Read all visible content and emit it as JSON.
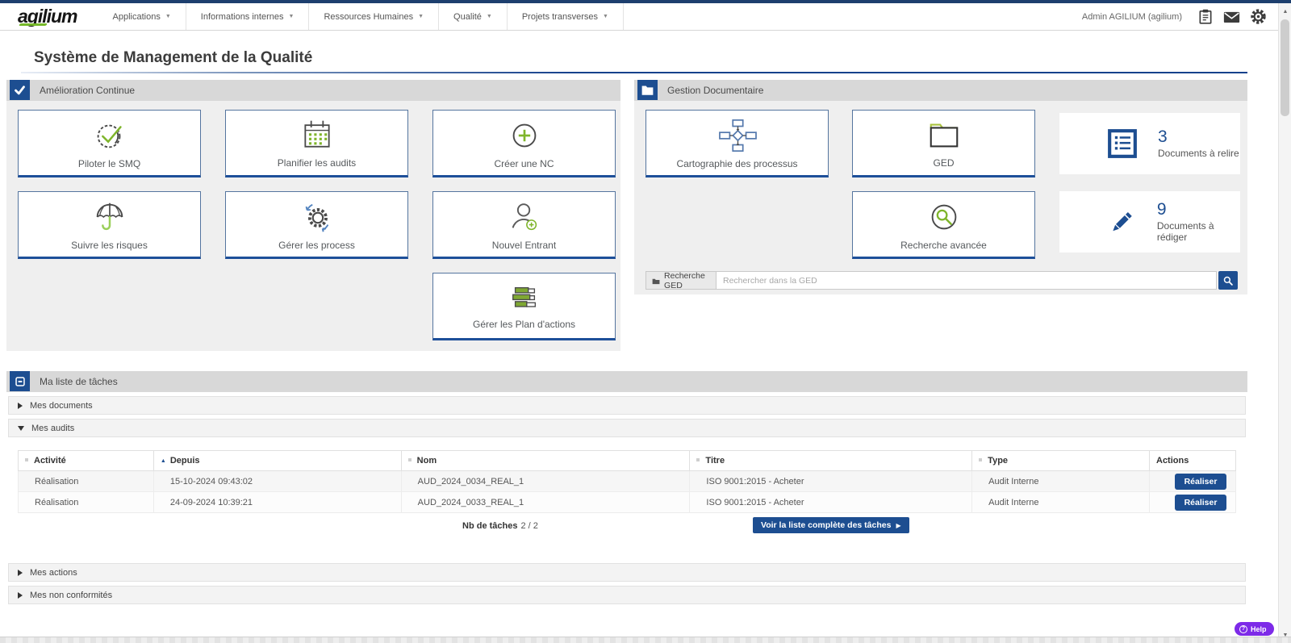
{
  "navbar": {
    "logo": "agilium",
    "menus": [
      "Applications",
      "Informations internes",
      "Ressources Humaines",
      "Qualité",
      "Projets transverses"
    ],
    "user": "Admin AGILIUM (agilium)"
  },
  "page": {
    "title": "Système de Management de la Qualité"
  },
  "amelioration": {
    "title": "Amélioration Continue",
    "tiles": [
      {
        "label": "Piloter le SMQ",
        "icon": "seal-check-icon"
      },
      {
        "label": "Planifier les audits",
        "icon": "calendar-icon"
      },
      {
        "label": "Créer une NC",
        "icon": "plus-circle-icon"
      },
      {
        "label": "Suivre les risques",
        "icon": "umbrella-icon"
      },
      {
        "label": "Gérer les process",
        "icon": "gear-sync-icon"
      },
      {
        "label": "Nouvel Entrant",
        "icon": "user-plus-icon"
      },
      {
        "label": "Gérer les Plan d'actions",
        "icon": "action-bars-icon"
      }
    ]
  },
  "gestion": {
    "title": "Gestion Documentaire",
    "tiles": [
      {
        "label": "Cartographie des processus",
        "icon": "flowchart-icon"
      },
      {
        "label": "GED",
        "icon": "folder-icon"
      },
      {
        "label": "Recherche avancée",
        "icon": "search-circle-icon"
      }
    ],
    "stats": [
      {
        "value": "3",
        "label": "Documents à relire",
        "icon": "list-icon"
      },
      {
        "value": "9",
        "label": "Documents à rédiger",
        "icon": "pencil-icon"
      }
    ],
    "search": {
      "label": "Recherche GED",
      "placeholder": "Rechercher dans la GED"
    }
  },
  "tasks": {
    "title": "Ma liste de tâches",
    "sections": {
      "documents": "Mes documents",
      "audits": "Mes audits",
      "actions": "Mes actions",
      "ncs": "Mes non conformités"
    },
    "table": {
      "columns": [
        "Activité",
        "Depuis",
        "Nom",
        "Titre",
        "Type",
        "Actions"
      ],
      "rows": [
        {
          "activite": "Réalisation",
          "depuis": "15-10-2024 09:43:02",
          "nom": "AUD_2024_0034_REAL_1",
          "titre": "ISO 9001:2015 - Acheter",
          "type": "Audit Interne",
          "action": "Réaliser"
        },
        {
          "activite": "Réalisation",
          "depuis": "24-09-2024 10:39:21",
          "nom": "AUD_2024_0033_REAL_1",
          "titre": "ISO 9001:2015 - Acheter",
          "type": "Audit Interne",
          "action": "Réaliser"
        }
      ],
      "count_label": "Nb de tâches",
      "count_value": "2 / 2",
      "view_all_label": "Voir la liste complète des tâches"
    }
  },
  "help": {
    "label": "Help"
  },
  "colors": {
    "primary_blue": "#1d4e91",
    "accent_green": "#7fb52b",
    "help_purple": "#7d2ae8",
    "top_strip": "#1d3f6e"
  }
}
